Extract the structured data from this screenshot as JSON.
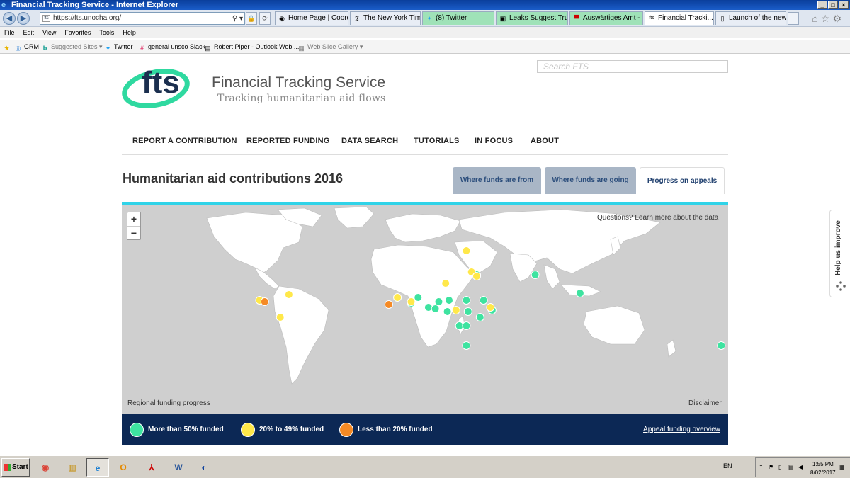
{
  "window": {
    "title": "Financial Tracking Service - Internet Explorer"
  },
  "address": {
    "url": "https://fts.unocha.org/"
  },
  "tabs": [
    {
      "label": "Home Page | Coord...",
      "icon": "globe-icon"
    },
    {
      "label": "The New York Time...",
      "icon": "nyt-icon"
    },
    {
      "label": "(8) Twitter",
      "icon": "twitter-icon"
    },
    {
      "label": "Leaks Suggest Tru...",
      "icon": "news-icon"
    },
    {
      "label": "Auswärtiges Amt - ...",
      "icon": "flag-icon"
    },
    {
      "label": "Financial Tracki...",
      "icon": "fts-icon"
    },
    {
      "label": "Launch of the new-...",
      "icon": "page-icon"
    }
  ],
  "menu": [
    "File",
    "Edit",
    "View",
    "Favorites",
    "Tools",
    "Help"
  ],
  "favorites": [
    {
      "label": "GRM",
      "icon": "un-icon"
    },
    {
      "label": "Suggested Sites ▾",
      "icon": "bing-icon"
    },
    {
      "label": "Twitter",
      "icon": "twitter-icon"
    },
    {
      "label": "general  unsco Slack",
      "icon": "slack-icon"
    },
    {
      "label": "Robert Piper - Outlook Web ...",
      "icon": "outlook-icon"
    },
    {
      "label": "Web Slice Gallery ▾",
      "icon": "webslice-icon"
    }
  ],
  "brand": {
    "logo_text": "fts",
    "title": "Financial Tracking Service",
    "subtitle": "Tracking humanitarian aid flows",
    "search_placeholder": "Search FTS",
    "accent": "#2fd9a0",
    "navy": "#1b2f4f"
  },
  "nav": [
    "REPORT A CONTRIBUTION",
    "REPORTED FUNDING",
    "DATA SEARCH",
    "TUTORIALS",
    "IN FOCUS",
    "ABOUT"
  ],
  "page": {
    "heading": "Humanitarian aid contributions 2016",
    "content_tabs": [
      {
        "label": "Where funds are from",
        "active": false
      },
      {
        "label": "Where funds are going",
        "active": false
      },
      {
        "label": "Progress on appeals",
        "active": true
      }
    ]
  },
  "map": {
    "zoom_in": "+",
    "zoom_out": "−",
    "questions": "Questions? Learn more about the data",
    "regional": "Regional funding progress",
    "disclaimer": "Disclaimer",
    "appeal_markers": [
      {
        "status": "over50",
        "lon": 70,
        "lat": 33
      },
      {
        "status": "over50",
        "lon": 96,
        "lat": 20
      },
      {
        "status": "over50",
        "lon": 36,
        "lat": 33
      },
      {
        "status": "over50",
        "lon": 40,
        "lat": 15
      },
      {
        "status": "over50",
        "lon": 45,
        "lat": 8
      },
      {
        "status": "over50",
        "lon": 30,
        "lat": 15
      },
      {
        "status": "over50",
        "lon": 31,
        "lat": 7
      },
      {
        "status": "over50",
        "lon": 20,
        "lat": 15
      },
      {
        "status": "over50",
        "lon": 14,
        "lat": 14
      },
      {
        "status": "over50",
        "lon": 2,
        "lat": 17
      },
      {
        "status": "over50",
        "lon": -2,
        "lat": 13
      },
      {
        "status": "over50",
        "lon": 8,
        "lat": 10
      },
      {
        "status": "over50",
        "lon": 19,
        "lat": 7
      },
      {
        "status": "over50",
        "lon": 12,
        "lat": 9
      },
      {
        "status": "over50",
        "lon": 38,
        "lat": 3
      },
      {
        "status": "over50",
        "lon": 26,
        "lat": -3
      },
      {
        "status": "over50",
        "lon": 30,
        "lat": -3
      },
      {
        "status": "over50",
        "lon": 30,
        "lat": -17
      },
      {
        "status": "over50",
        "lon": 178,
        "lat": -17
      },
      {
        "status": "20to49",
        "lon": 30,
        "lat": 50
      },
      {
        "status": "20to49",
        "lon": 33,
        "lat": 35
      },
      {
        "status": "20to49",
        "lon": 36,
        "lat": 32
      },
      {
        "status": "20to49",
        "lon": 18,
        "lat": 27
      },
      {
        "status": "20to49",
        "lon": -10,
        "lat": 17
      },
      {
        "status": "20to49",
        "lon": -2,
        "lat": 14
      },
      {
        "status": "20to49",
        "lon": 24,
        "lat": 8
      },
      {
        "status": "20to49",
        "lon": 44,
        "lat": 10
      },
      {
        "status": "20to49",
        "lon": -90,
        "lat": 15
      },
      {
        "status": "20to49",
        "lon": -73,
        "lat": 19
      },
      {
        "status": "20to49",
        "lon": -78,
        "lat": 3
      },
      {
        "status": "under20",
        "lon": -87,
        "lat": 14
      },
      {
        "status": "under20",
        "lon": -15,
        "lat": 12
      }
    ]
  },
  "legend": {
    "items": [
      {
        "label": "More than 50% funded",
        "color": "#3ee3a0",
        "status": "over50"
      },
      {
        "label": "20% to 49% funded",
        "color": "#ffe84a",
        "status": "20to49"
      },
      {
        "label": "Less than 20% funded",
        "color": "#f58a25",
        "status": "under20"
      }
    ],
    "link": "Appeal funding overview"
  },
  "feedback": {
    "label": "Help us improve"
  },
  "taskbar": {
    "start": "Start",
    "apps": [
      "chrome-icon",
      "explorer-icon",
      "ie-icon",
      "outlook-icon",
      "acrobat-icon",
      "word-icon",
      "app-icon"
    ],
    "lang": "EN",
    "time": "1:55 PM",
    "date": "8/02/2017"
  }
}
